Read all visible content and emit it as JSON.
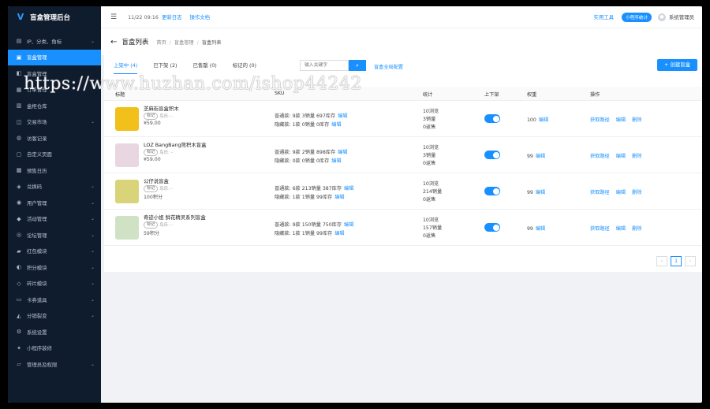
{
  "brand": {
    "title": "盲盒管理后台"
  },
  "sidebar": {
    "items": [
      {
        "label": "IP、分类、角标",
        "icon": "layers-icon",
        "chevron": true
      },
      {
        "label": "盲盒管理",
        "icon": "box-icon",
        "chevron": false,
        "active": true
      },
      {
        "label": "盲盒管理",
        "icon": "bag-icon",
        "chevron": false
      },
      {
        "label": "订单管理",
        "icon": "order-icon",
        "chevron": false
      },
      {
        "label": "盒柜仓库",
        "icon": "warehouse-icon",
        "chevron": false
      },
      {
        "label": "交易市场",
        "icon": "market-icon",
        "chevron": true
      },
      {
        "label": "访客记录",
        "icon": "visitor-icon",
        "chevron": false
      },
      {
        "label": "自定义页面",
        "icon": "page-icon",
        "chevron": false
      },
      {
        "label": "预售日历",
        "icon": "calendar-icon",
        "chevron": false
      },
      {
        "label": "兑换码",
        "icon": "code-icon",
        "chevron": true
      },
      {
        "label": "用户管理",
        "icon": "user-icon",
        "chevron": true
      },
      {
        "label": "活动管理",
        "icon": "activity-icon",
        "chevron": true
      },
      {
        "label": "论坛管理",
        "icon": "forum-icon",
        "chevron": true
      },
      {
        "label": "红包模块",
        "icon": "redpacket-icon",
        "chevron": true
      },
      {
        "label": "积分模块",
        "icon": "points-icon",
        "chevron": true
      },
      {
        "label": "碎片模块",
        "icon": "fragment-icon",
        "chevron": true
      },
      {
        "label": "卡券道具",
        "icon": "coupon-icon",
        "chevron": true
      },
      {
        "label": "分销裂变",
        "icon": "share-icon",
        "chevron": true
      },
      {
        "label": "系统设置",
        "icon": "settings-icon",
        "chevron": false
      },
      {
        "label": "小程序装修",
        "icon": "decorate-icon",
        "chevron": false
      },
      {
        "label": "管理员及权限",
        "icon": "admin-icon",
        "chevron": true
      }
    ]
  },
  "topbar": {
    "time": "11/22 09:16",
    "changelog": "更新日志",
    "docs": "操作文档",
    "tools": "实用工具",
    "miniprogram_stats": "小程序统计",
    "admin_name": "系统管理员"
  },
  "page": {
    "title": "盲盒列表",
    "breadcrumb": [
      "首页",
      "盲盒管理",
      "盲盒列表"
    ]
  },
  "tabs": [
    "上架中 (4)",
    "已下架 (2)",
    "已售罄 (0)",
    "标记的 (0)"
  ],
  "search": {
    "placeholder": "输入关键字"
  },
  "global_config": "盲盒全局配置",
  "create_button": "创建盲盒",
  "table": {
    "headers": [
      "标题",
      "SKU",
      "统计",
      "上下架",
      "权重",
      "操作"
    ],
    "rows": [
      {
        "name": "芝麻街盲盒积木",
        "tag": "标记",
        "shop": "鸟乐: -",
        "price": "¥59.00",
        "sku_normal": "普通款: 9款 3销量 697库存",
        "sku_hidden": "隐藏款: 1款 0销量 0库存",
        "stat1": "10浏览",
        "stat2": "3销量",
        "stat3": "0返售",
        "on_sale": true,
        "weight": "100",
        "thumb_color": "#f2c01b"
      },
      {
        "name": "LOZ BangBang熊积木盲盒",
        "tag": "标记",
        "shop": "鸟乐: -",
        "price": "¥59.00",
        "sku_normal": "普通款: 9款 2销量 898库存",
        "sku_hidden": "隐藏款: 0款 0销量 0库存",
        "stat1": "10浏览",
        "stat2": "3销量",
        "stat3": "0返售",
        "on_sale": true,
        "weight": "99",
        "thumb_color": "#e8d6e0"
      },
      {
        "name": "公仔说盲盒",
        "tag": "标记",
        "shop": "鸟乐: -",
        "price": "100积分",
        "sku_normal": "普通款: 6款 213销量 387库存",
        "sku_hidden": "隐藏款: 1款 1销量 99库存",
        "stat1": "10浏览",
        "stat2": "214销量",
        "stat3": "0返售",
        "on_sale": true,
        "weight": "99",
        "thumb_color": "#d9d47a"
      },
      {
        "name": "奇迹小姐 鲜花精灵系列盲盒",
        "tag": "标记",
        "shop": "鸟乐: -",
        "price": "59积分",
        "sku_normal": "普通款: 9款 150销量 750库存",
        "sku_hidden": "隐藏款: 1款 1销量 99库存",
        "stat1": "10浏览",
        "stat2": "157销量",
        "stat3": "0返售",
        "on_sale": true,
        "weight": "99",
        "thumb_color": "#cfe3c4"
      }
    ],
    "edit_label": "编辑",
    "ops": [
      "获取路径",
      "编辑",
      "删除"
    ]
  },
  "pagination": {
    "current": "1"
  },
  "watermark": "https://www.huzhan.com/ishop44242",
  "colors": {
    "accent": "#1890ff",
    "sidebar_bg": "#0f1c2e"
  }
}
